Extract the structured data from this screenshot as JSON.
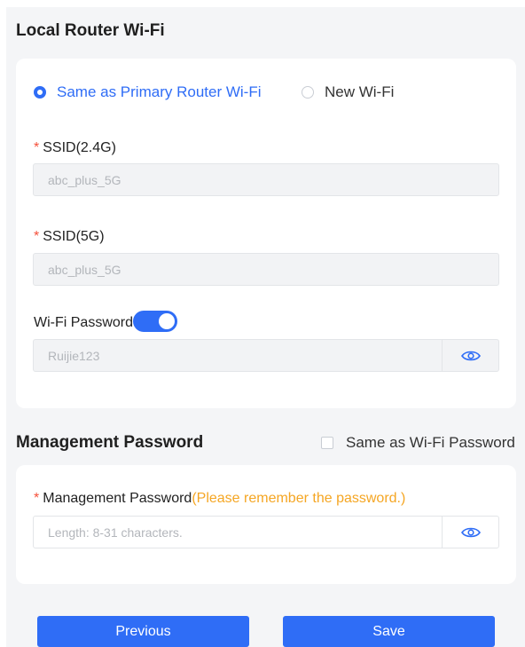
{
  "local_wifi": {
    "title": "Local Router Wi-Fi",
    "options": {
      "same_label": "Same as Primary Router Wi-Fi",
      "new_label": "New Wi-Fi",
      "selected": "same"
    },
    "ssid_24": {
      "required_mark": "*",
      "label": "SSID(2.4G)",
      "value": "abc_plus_5G"
    },
    "ssid_5": {
      "required_mark": "*",
      "label": "SSID(5G)",
      "value": "abc_plus_5G"
    },
    "wifi_password": {
      "label": "Wi-Fi Password",
      "toggle_on": true,
      "value": "Ruijie123"
    }
  },
  "management": {
    "title": "Management Password",
    "same_as_wifi_label": "Same as Wi-Fi Password",
    "same_as_wifi_checked": false,
    "field": {
      "required_mark": "*",
      "label": "Management Password",
      "hint": "(Please remember the password.)",
      "placeholder": "Length: 8-31 characters."
    }
  },
  "buttons": {
    "previous": "Previous",
    "save": "Save"
  },
  "colors": {
    "primary": "#2f6df6",
    "required": "#f5503a",
    "hint": "#f5a623"
  },
  "icons": {
    "eye": "eye-icon"
  }
}
